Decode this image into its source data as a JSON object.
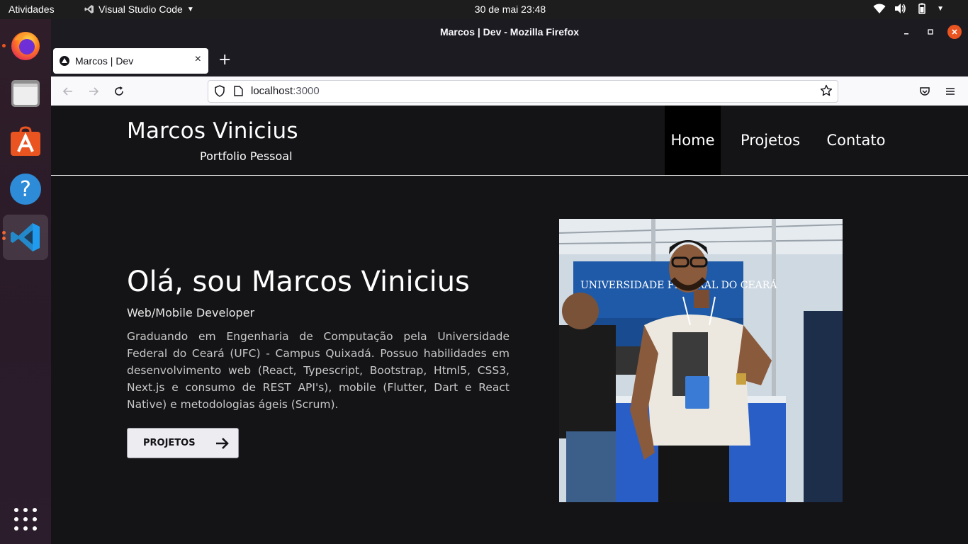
{
  "topbar": {
    "activities": "Atividades",
    "app_name": "Visual Studio Code",
    "clock": "30 de mai  23:48"
  },
  "dock": {
    "items": [
      "firefox-icon",
      "files-icon",
      "app-center-icon",
      "help-icon",
      "vscode-icon",
      "show-apps-icon"
    ]
  },
  "window": {
    "title": "Marcos | Dev - Mozilla Firefox"
  },
  "tabs": [
    {
      "title": "Marcos | Dev"
    }
  ],
  "urlbar": {
    "host": "localhost",
    "port": ":3000"
  },
  "site": {
    "brand": "Marcos Vinicius",
    "tagline": "Portfolio Pessoal",
    "nav": [
      {
        "label": "Home",
        "active": true
      },
      {
        "label": "Projetos",
        "active": false
      },
      {
        "label": "Contato",
        "active": false
      }
    ],
    "hero": {
      "title": "Olá, sou Marcos Vinicius",
      "role": "Web/Mobile Developer",
      "description": "Graduando em Engenharia de Computação pela Universidade Federal do Ceará (UFC) - Campus Quixadá. Possuo habilidades em desenvolvimento web (React, Typescript, Bootstrap, Html5, CSS3, Next.js e consumo de REST API's), mobile (Flutter, Dart e React Native) e metodologias ágeis (Scrum).",
      "button": "PROJETOS"
    },
    "photo_banner": "UNIVERSIDADE FEDERAL DO CEARÁ"
  },
  "colors": {
    "site_bg": "#141316",
    "nav_active_bg": "#000000",
    "ubuntu_orange": "#e95420"
  }
}
